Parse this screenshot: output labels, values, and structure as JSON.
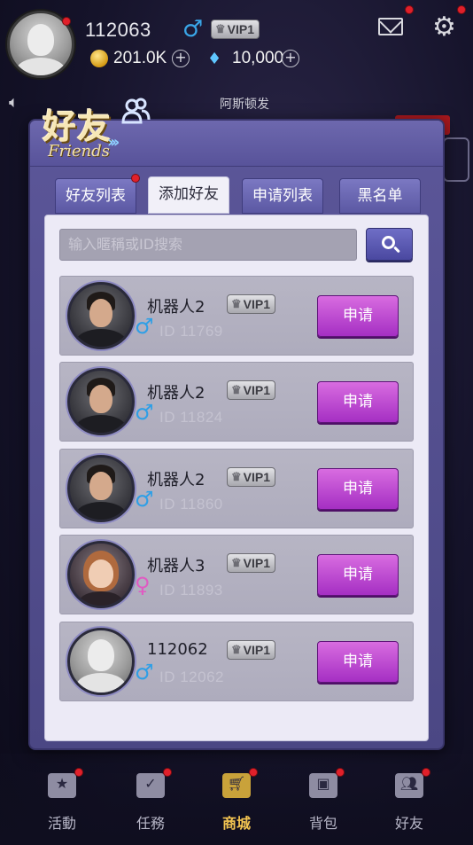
{
  "player": {
    "id": "112063",
    "gender_symbol": "♂",
    "vip": "VIP1",
    "coins": "201.0K",
    "diamonds": "10,000",
    "plus": "+"
  },
  "marquee": "阿斯顿发",
  "panel": {
    "title_cn": "好友",
    "title_en": "Friends",
    "tabs": [
      {
        "label": "好友列表",
        "active": false,
        "badge": true
      },
      {
        "label": "添加好友",
        "active": true,
        "badge": false
      },
      {
        "label": "申请列表",
        "active": false,
        "badge": false
      },
      {
        "label": "黑名单",
        "active": false,
        "badge": false
      }
    ],
    "search": {
      "placeholder": "输入暱稱或ID搜索"
    }
  },
  "results": [
    {
      "name": "机器人2",
      "vip": "VIP1",
      "gender": "♂",
      "gender_class": "male",
      "id_label": "ID  11769",
      "button": "申请",
      "avatar": "male"
    },
    {
      "name": "机器人2",
      "vip": "VIP1",
      "gender": "♂",
      "gender_class": "male",
      "id_label": "ID  11824",
      "button": "申请",
      "avatar": "male"
    },
    {
      "name": "机器人2",
      "vip": "VIP1",
      "gender": "♂",
      "gender_class": "male",
      "id_label": "ID  11860",
      "button": "申请",
      "avatar": "male"
    },
    {
      "name": "机器人3",
      "vip": "VIP1",
      "gender": "♀",
      "gender_class": "female",
      "id_label": "ID  11893",
      "button": "申请",
      "avatar": "female"
    },
    {
      "name": "112062",
      "vip": "VIP1",
      "gender": "♂",
      "gender_class": "male",
      "id_label": "ID  12062",
      "button": "申请",
      "avatar": "default"
    }
  ],
  "bottom_nav": [
    {
      "label": "活動",
      "icon": "star-card-icon",
      "badge": true,
      "active": false
    },
    {
      "label": "任務",
      "icon": "calendar-check-icon",
      "badge": true,
      "active": false
    },
    {
      "label": "商城",
      "icon": "shopping-cart-icon",
      "badge": true,
      "active": true
    },
    {
      "label": "背包",
      "icon": "backpack-icon",
      "badge": true,
      "active": false
    },
    {
      "label": "好友",
      "icon": "friends-icon",
      "badge": true,
      "active": false
    }
  ],
  "colors": {
    "accent_purple": "#a52fc3",
    "panel": "#5a5597",
    "male": "#2f9fe6",
    "female": "#e05ac2",
    "active_nav": "#f3c451"
  }
}
